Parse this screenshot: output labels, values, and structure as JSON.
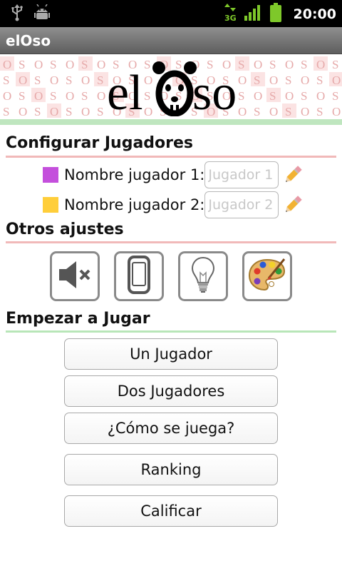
{
  "status_bar": {
    "time": "20:00",
    "network": "3G",
    "icons": [
      "usb-icon",
      "android-debug-icon",
      "data-3g-icon",
      "signal-icon",
      "battery-icon"
    ]
  },
  "app": {
    "title": "elOso"
  },
  "banner": {
    "logo_text": "elOso",
    "pattern_letters": [
      "O",
      "S"
    ]
  },
  "players_section": {
    "title": "Configurar Jugadores",
    "players": [
      {
        "label": "Nombre jugador 1:",
        "placeholder": "Jugador 1",
        "color": "#c44fdc"
      },
      {
        "label": "Nombre jugador 2:",
        "placeholder": "Jugador 2",
        "color": "#ffce3a"
      }
    ]
  },
  "settings_section": {
    "title": "Otros ajustes",
    "buttons": [
      "sound-muted-icon",
      "device-icon",
      "lightbulb-icon",
      "palette-icon"
    ]
  },
  "play_section": {
    "title": "Empezar a Jugar",
    "buttons": [
      "Un Jugador",
      "Dos Jugadores",
      "¿Cómo se juega?",
      "Ranking",
      "Calificar"
    ]
  },
  "colors": {
    "red_rule": "#f1b9b9",
    "green_rule": "#b8e6b8",
    "titlebar": "#7a7a7a"
  }
}
